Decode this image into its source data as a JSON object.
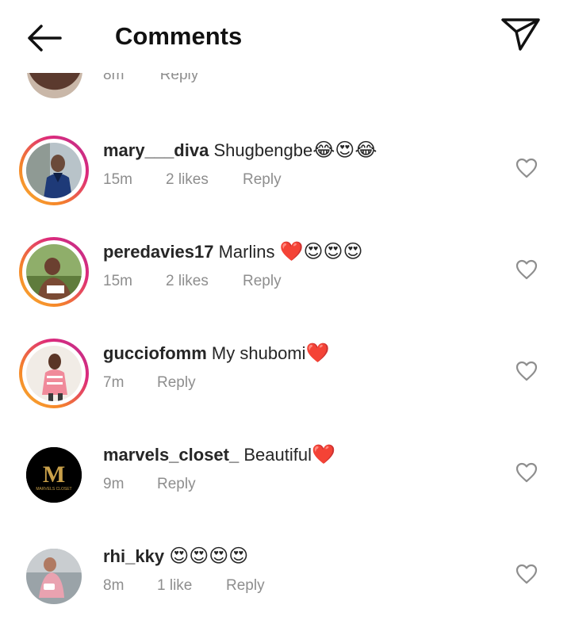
{
  "header": {
    "title": "Comments"
  },
  "partial_comment": {
    "time": "8m",
    "reply_label": "Reply"
  },
  "comments": [
    {
      "username": "mary___diva",
      "text": "Shugbengbe",
      "emojis": "😂😍😂",
      "time": "15m",
      "likes": "2 likes",
      "reply_label": "Reply",
      "story_ring": true
    },
    {
      "username": "peredavies17",
      "text": "Marlins",
      "emojis": "❤️😍😍😍",
      "time": "15m",
      "likes": "2 likes",
      "reply_label": "Reply",
      "story_ring": true
    },
    {
      "username": "gucciofomm",
      "text": "My shubomi",
      "emojis": "❤️",
      "time": "7m",
      "likes": "",
      "reply_label": "Reply",
      "story_ring": true
    },
    {
      "username": "marvels_closet_",
      "text": "Beautiful",
      "emojis": "❤️",
      "time": "9m",
      "likes": "",
      "reply_label": "Reply",
      "story_ring": false,
      "avatar_logo_letter": "M",
      "avatar_logo_caption": "MARVELS CLOSET"
    },
    {
      "username": "rhi_kky",
      "text": "",
      "emojis": "😍😍😍😍",
      "time": "8m",
      "likes": "1 like",
      "reply_label": "Reply",
      "story_ring": false
    }
  ],
  "colors": {
    "text": "#262626",
    "meta": "#8e8e8e",
    "heart": "#e0182d",
    "ring_start": "#f9b233",
    "ring_end": "#b9318f"
  },
  "icons": {
    "back": "arrow-left-icon",
    "share": "paper-plane-icon",
    "like": "heart-outline-icon"
  }
}
